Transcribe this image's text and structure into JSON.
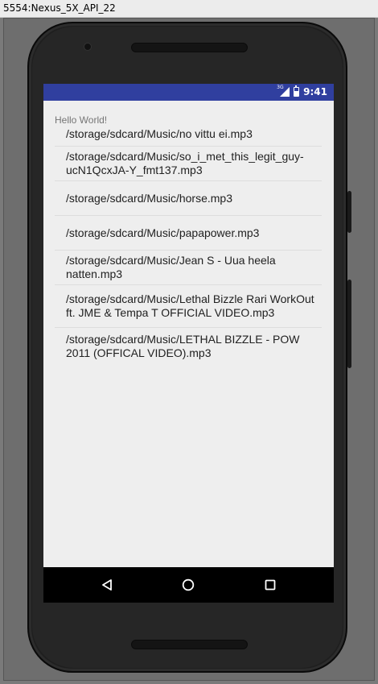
{
  "window": {
    "title": "5554:Nexus_5X_API_22"
  },
  "statusbar": {
    "network": "3G",
    "time": "9:41"
  },
  "app": {
    "hello_text": "Hello World!"
  },
  "files": [
    "/storage/sdcard/Music/no vittu ei.mp3",
    "/storage/sdcard/Music/so_i_met_this_legit_guy-ucN1QcxJA-Y_fmt137.mp3",
    "/storage/sdcard/Music/horse.mp3",
    "/storage/sdcard/Music/papapower.mp3",
    "/storage/sdcard/Music/Jean S - Uua heela natten.mp3",
    "/storage/sdcard/Music/Lethal Bizzle Rari WorkOut ft. JME & Tempa T OFFICIAL VIDEO.mp3",
    "/storage/sdcard/Music/LETHAL BIZZLE - POW 2011 (OFFICAL VIDEO).mp3"
  ],
  "navbar": {
    "icons": [
      "back-icon",
      "home-icon",
      "recents-icon"
    ]
  },
  "colors": {
    "statusbar": "#303f9f",
    "screen_bg": "#eeeeee",
    "navbar": "#000000"
  }
}
